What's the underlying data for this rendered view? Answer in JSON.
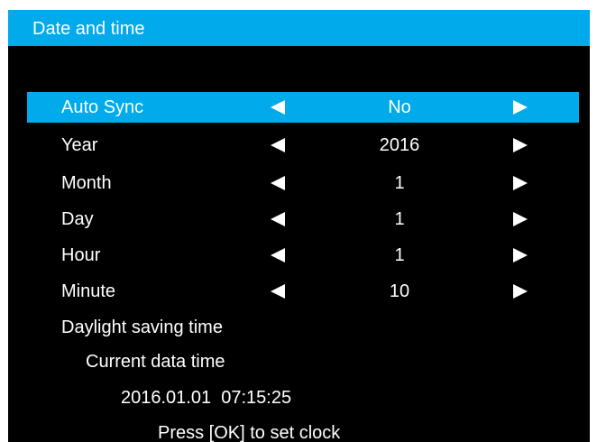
{
  "window": {
    "title": "Date and time"
  },
  "menu": {
    "rows": [
      {
        "label": "Auto Sync",
        "value": "No",
        "selected": true
      },
      {
        "label": "Year",
        "value": "2016",
        "selected": false
      },
      {
        "label": "Month",
        "value": "1",
        "selected": false
      },
      {
        "label": "Day",
        "value": "1",
        "selected": false
      },
      {
        "label": "Hour",
        "value": "1",
        "selected": false
      },
      {
        "label": "Minute",
        "value": "10",
        "selected": false
      }
    ],
    "daylight_saving_label": "Daylight saving time"
  },
  "clock": {
    "heading": "Current data time",
    "current_datetime": "2016.01.01  07:15:25",
    "hint": "Press [OK] to set clock"
  },
  "colors": {
    "accent": "#00aaeb",
    "background": "#000000",
    "text": "#ffffff"
  },
  "icons": {
    "decrease": "left-triangle-arrow",
    "increase": "right-triangle-arrow"
  }
}
